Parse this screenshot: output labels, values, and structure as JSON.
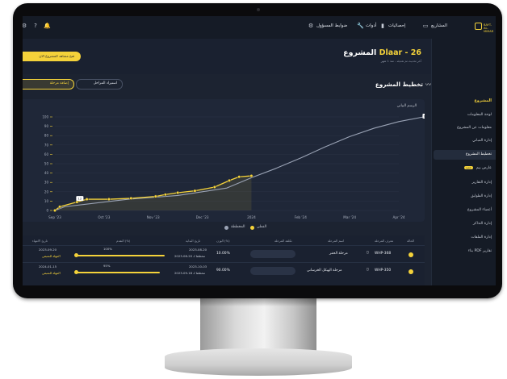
{
  "app": {
    "brand": "BAYT-AL-MIMAR",
    "nav": [
      "المشاريع",
      "إحصائيات",
      "أدوات",
      "ضوابط المسؤول"
    ]
  },
  "project": {
    "code": "Dlaar - 26",
    "title": "المشروع",
    "subtitle": "آخر تحديث تم تعديله - منذ 1 شهر",
    "snapshot_button": "فتح مشاهد المشروع الان"
  },
  "sidebar": {
    "heading": "المشروع",
    "items": [
      "لوحة المعلومات",
      "معلومات عن المشروع",
      "إدارة المباني",
      "تخطيط المشروع",
      "عارض بيم",
      "إدارة التقارير",
      "إدارة الطوابق",
      "أعضاء المشروع",
      "إدارة التذاكر",
      "إدارة الملفات",
      "بناء PDF تقارير"
    ],
    "badge": "جديد"
  },
  "page": {
    "section_title": "تخطيط المشروع",
    "import_button": "استيراد المراحل",
    "add_button": "إضافة مرحلة"
  },
  "chart_data": {
    "type": "line",
    "title": "الرسم البياني",
    "x_ticks": [
      "Sep '23",
      "Oct '23",
      "Nov '23",
      "Dec '23",
      "2024",
      "Feb '24",
      "Mar '24",
      "Apr '24"
    ],
    "y_ticks": [
      0,
      10,
      20,
      30,
      40,
      50,
      60,
      70,
      80,
      90,
      100
    ],
    "ylim": [
      0,
      100
    ],
    "series": [
      {
        "name": "المخطط",
        "color": "#9aa3b5",
        "x": [
          0,
          0.2,
          1,
          1.5,
          2,
          2.5,
          3,
          3.5,
          4,
          4.5,
          5,
          5.5,
          6,
          6.5,
          7,
          7.5
        ],
        "y": [
          0,
          4,
          9,
          12,
          14,
          16,
          20,
          24,
          35,
          45,
          56,
          68,
          79,
          88,
          95,
          100
        ]
      },
      {
        "name": "الفعلي",
        "color": "#f4d23a",
        "x": [
          0,
          0.1,
          0.45,
          0.65,
          1.1,
          1.55,
          2.05,
          2.25,
          2.5,
          2.85,
          3.25,
          3.55,
          3.75,
          4.0
        ],
        "y": [
          0,
          4,
          9,
          12,
          12,
          13,
          15,
          17,
          19,
          21,
          25,
          32,
          36,
          37
        ]
      }
    ],
    "point_labels": [
      {
        "x": 0.45,
        "y": 12,
        "label": "12"
      },
      {
        "x": 7.5,
        "y": 100,
        "label": "100"
      }
    ]
  },
  "legend": {
    "actual": "الفعلي",
    "planned": "المخططة"
  },
  "table": {
    "headers": [
      "الحالة",
      "معرف المرحلة",
      "اسم المرحلة",
      "تكلفة المرحلة",
      "الوزن (%)",
      "تاريخ البداية",
      "التقدم (%)",
      "تاريخ الانتهاء"
    ],
    "rows": [
      {
        "id": "WHP-368",
        "name": "مرحلة الحفر",
        "weight": "10.00%",
        "start": "2023-08-20",
        "start_note": "مخطط لـ 20-08-2023",
        "progress": "100%",
        "progress_value": 1.0,
        "end": "2023-09-20",
        "end_note": "المهلة للمتبقي"
      },
      {
        "id": "WHP-350",
        "name": "مرحلة الهيكل الخرساني",
        "weight": "90.00%",
        "start": "2023-10-03",
        "start_note": "مخطط لـ 18-09-2023",
        "progress": "95%",
        "progress_value": 0.95,
        "end": "2024-01-15",
        "end_note": "المهلة للمتبقي"
      }
    ]
  }
}
